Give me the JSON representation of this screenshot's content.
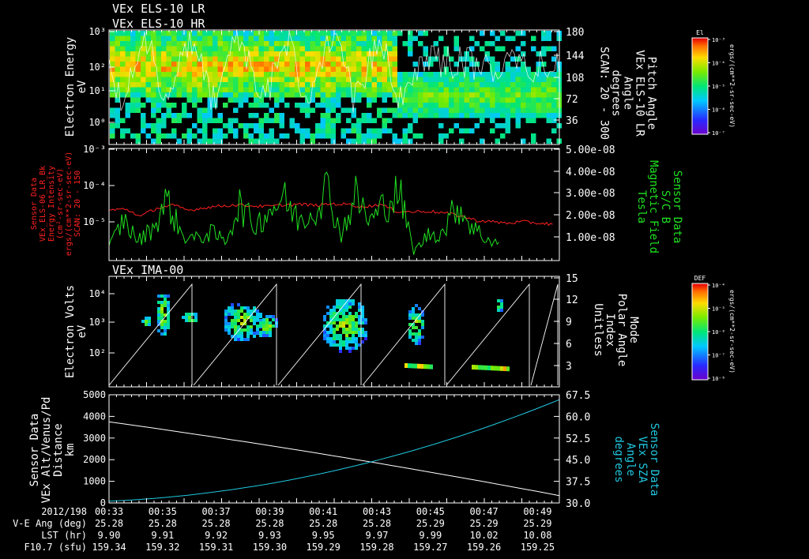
{
  "titles": {
    "line1": "VEx ELS-10 LR",
    "line2": "VEx ELS-10 HR",
    "ima": "VEx IMA-00"
  },
  "chart_data": [
    {
      "type": "heatmap",
      "name": "els-spectrogram",
      "ylabel": [
        "Electron Energy",
        "eV"
      ],
      "yticks": [
        "10⁰",
        "10¹",
        "10²",
        "10³"
      ],
      "ylim": [
        0.5,
        1000
      ],
      "y2label": [
        "Pitch Angle",
        "VEx ELS-10 LR",
        "Angle",
        "degrees",
        "SCAN: 20 - 300"
      ],
      "y2ticks": [
        "180",
        "144",
        "108",
        "72",
        "36"
      ],
      "colorbar": {
        "title": "El",
        "label": "ergs/(cm**2-sr-sec-eV)",
        "ticks": [
          "10⁻³",
          "10⁻⁴",
          "10⁻⁵",
          "10⁻⁶",
          "10⁻⁷"
        ]
      }
    },
    {
      "type": "line",
      "name": "energy-intensity-and-magnetic-field",
      "ylabel": [
        "Sensor Data",
        "VEx_ELS-06_LR_Bk",
        "Energy Intensity",
        "(cm²-sr-sec-eV)",
        "ergs/(cm**2-sr-sec-eV)",
        "SCAN: 20 - 150"
      ],
      "yticks": [
        "10⁻³",
        "10⁻⁴",
        "10⁻⁵"
      ],
      "y2label": [
        "Sensor Data",
        "S/C B",
        "Magnetic Field",
        "Tesla"
      ],
      "y2ticks": [
        "5.00e-08",
        "4.00e-08",
        "3.00e-08",
        "2.00e-08",
        "1.00e-08"
      ],
      "series": [
        {
          "name": "energy-intensity",
          "color": "#ff2020",
          "values": [
            2.2e-05,
            2.4e-05,
            1.5e-05,
            2.5e-05,
            3e-05,
            2.2e-05,
            2.6e-05,
            2.9e-05,
            3.1e-05,
            2.9e-05,
            2.8e-05,
            3.1e-05,
            3.2e-05,
            3e-05,
            3.3e-05,
            3.2e-05,
            2.7e-05,
            3.2e-05,
            2.1e-05,
            2e-05,
            2.1e-05,
            1.9e-05,
            1.6e-05,
            1.2e-05,
            1.1e-05,
            1e-05,
            1.1e-05,
            1e-05,
            9.5e-06
          ]
        },
        {
          "name": "magnetic-field",
          "color": "#20e020",
          "values": [
            6e-09,
            1.9e-08,
            9e-09,
            1.5e-08,
            2.8e-08,
            1.2e-08,
            1e-08,
            1.3e-08,
            9e-09,
            2.6e-08,
            1.6e-08,
            2.3e-08,
            2.9e-08,
            1.9e-08,
            2.2e-08,
            3.4e-08,
            1.2e-08,
            3e-08,
            1.8e-08,
            2.6e-08,
            3.2e-08,
            4e-09,
            1.2e-08,
            1.3e-08,
            2.6e-08,
            1.6e-08,
            1e-08,
            8e-09
          ]
        }
      ]
    },
    {
      "type": "heatmap",
      "name": "ima-spectrogram",
      "ylabel": [
        "Electron Volts",
        "eV"
      ],
      "yticks": [
        "10²",
        "10³",
        "10⁴"
      ],
      "y2label": [
        "Mode",
        "Polar Angle",
        "Index",
        "Unitless"
      ],
      "y2ticks": [
        "15",
        "12",
        "9",
        "6",
        "3"
      ],
      "colorbar": {
        "title": "DEF",
        "label": "ergs/(cm**2-sr-sec-eV)",
        "ticks": [
          "10⁻⁴",
          "10⁻⁵",
          "10⁻⁶",
          "10⁻⁷",
          "10⁻⁸"
        ]
      }
    },
    {
      "type": "line",
      "name": "altitude-and-sza",
      "ylabel": [
        "Sensor Data",
        "VEx Alt/Venus/Pd",
        "Distance",
        "km"
      ],
      "yticks": [
        "0",
        "1000",
        "2000",
        "3000",
        "4000",
        "5000"
      ],
      "ylim": [
        0,
        5000
      ],
      "y2label": [
        "Sensor Data",
        "VEx SZA",
        "Angle",
        "degrees"
      ],
      "y2ticks": [
        "67.5",
        "60.0",
        "52.5",
        "45.0",
        "37.5",
        "30.0"
      ],
      "y2lim": [
        30,
        67.5
      ],
      "series": [
        {
          "name": "altitude",
          "color": "#ffffff",
          "x_minutes": [
            0,
            17
          ],
          "values": [
            3750,
            340
          ]
        },
        {
          "name": "sza",
          "color": "#20c8e0",
          "x_minutes": [
            0,
            17
          ],
          "values": [
            30.6,
            65.8
          ]
        }
      ]
    }
  ],
  "time_axis": {
    "row_labels": [
      "2012/198",
      "V-E Ang (deg)",
      "LST (hr)",
      "F10.7 (sfu)"
    ],
    "columns": [
      {
        "time": "00:33",
        "ve_ang": "25.28",
        "lst": "9.90",
        "f107": "159.34"
      },
      {
        "time": "00:35",
        "ve_ang": "25.28",
        "lst": "9.91",
        "f107": "159.32"
      },
      {
        "time": "00:37",
        "ve_ang": "25.28",
        "lst": "9.92",
        "f107": "159.31"
      },
      {
        "time": "00:39",
        "ve_ang": "25.28",
        "lst": "9.93",
        "f107": "159.30"
      },
      {
        "time": "00:41",
        "ve_ang": "25.28",
        "lst": "9.95",
        "f107": "159.29"
      },
      {
        "time": "00:43",
        "ve_ang": "25.28",
        "lst": "9.97",
        "f107": "159.28"
      },
      {
        "time": "00:45",
        "ve_ang": "25.29",
        "lst": "9.99",
        "f107": "159.27"
      },
      {
        "time": "00:47",
        "ve_ang": "25.29",
        "lst": "10.02",
        "f107": "159.26"
      },
      {
        "time": "00:49",
        "ve_ang": "25.29",
        "lst": "10.08",
        "f107": "159.25"
      }
    ]
  },
  "colors": {
    "background": "#000000",
    "axes": "#ffffff",
    "red_series": "#ff2020",
    "green_series": "#20e020",
    "cyan_series": "#20c8e0"
  }
}
